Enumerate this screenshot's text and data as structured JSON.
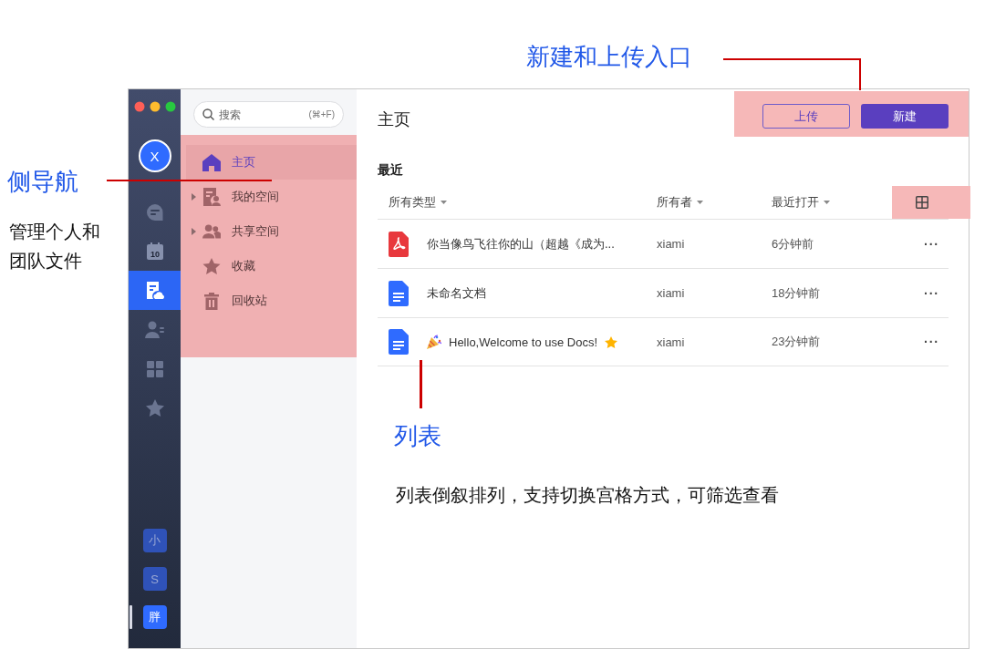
{
  "window": {
    "avatar": "X",
    "rail": [
      {
        "kind": "chat",
        "selected": false
      },
      {
        "kind": "calendar",
        "label": "10",
        "selected": false
      },
      {
        "kind": "docs",
        "selected": true
      },
      {
        "kind": "contacts",
        "selected": false
      },
      {
        "kind": "apps",
        "selected": false
      },
      {
        "kind": "star",
        "selected": false
      }
    ],
    "workspaces": [
      {
        "label": "小",
        "selected": false
      },
      {
        "label": "S",
        "selected": false
      },
      {
        "label": "胖",
        "selected": true
      }
    ],
    "search": {
      "placeholder": "搜索",
      "shortcut": "(⌘+F)"
    },
    "nav": [
      {
        "kind": "home",
        "label": "主页",
        "selected": true,
        "expandable": false
      },
      {
        "kind": "myspace",
        "label": "我的空间",
        "selected": false,
        "expandable": true
      },
      {
        "kind": "shared",
        "label": "共享空间",
        "selected": false,
        "expandable": true
      },
      {
        "kind": "star",
        "label": "收藏",
        "selected": false,
        "expandable": false
      },
      {
        "kind": "trash",
        "label": "回收站",
        "selected": false,
        "expandable": false
      }
    ],
    "title": "主页",
    "buttons": [
      {
        "kind": "outline",
        "label": "上传"
      },
      {
        "kind": "primary",
        "label": "新建"
      }
    ],
    "section": "最近",
    "columns": [
      "所有类型",
      "所有者",
      "最近打开"
    ],
    "rows": [
      {
        "kind": "pdf",
        "name": "你当像鸟飞往你的山（超越《成为...",
        "owner": "xiami",
        "opened": "6分钟前",
        "party": false,
        "starred": false,
        "more": "···"
      },
      {
        "kind": "doc",
        "name": "未命名文档",
        "owner": "xiami",
        "opened": "18分钟前",
        "party": false,
        "starred": false,
        "more": "···"
      },
      {
        "kind": "doc",
        "name": "Hello,Welcome to use Docs!",
        "owner": "xiami",
        "opened": "23分钟前",
        "party": true,
        "starred": true,
        "more": "···"
      }
    ]
  },
  "annotations": [
    {
      "kind": "heading",
      "text": "新建和上传入口"
    },
    {
      "kind": "heading",
      "text": "侧导航"
    },
    {
      "kind": "note",
      "text": "管理个人和"
    },
    {
      "kind": "note",
      "text": "团队文件"
    },
    {
      "kind": "heading",
      "text": "列表"
    },
    {
      "kind": "note",
      "text": "列表倒叙排列，支持切换宫格方式，可筛选查看"
    }
  ]
}
